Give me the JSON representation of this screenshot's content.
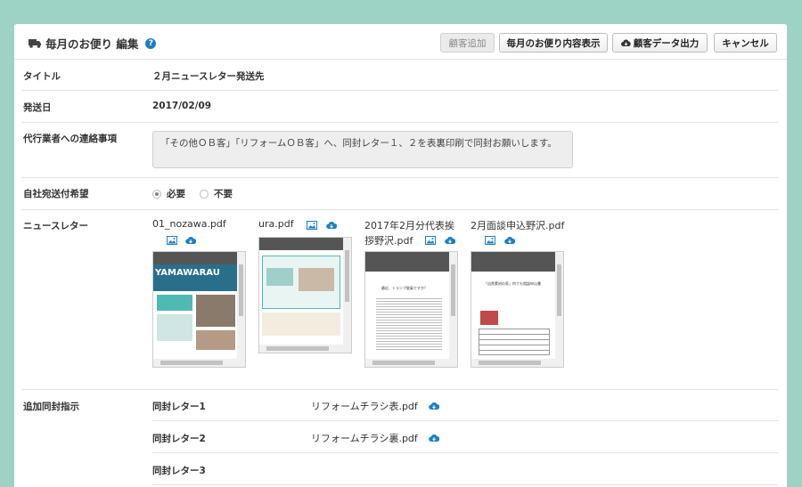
{
  "header": {
    "title": "毎月のお便り 編集",
    "help_icon": "?",
    "buttons": {
      "add_customer": "顧客追加",
      "show_content": "毎月のお便り内容表示",
      "export_data": "顧客データ出力",
      "cancel": "キャンセル"
    }
  },
  "form": {
    "title": {
      "label": "タイトル",
      "value": "２月ニュースレター発送先"
    },
    "send_date": {
      "label": "発送日",
      "value": "2017/02/09"
    },
    "agent_note": {
      "label": "代行業者への連絡事項",
      "value": "「その他ＯＢ客」「リフォームＯＢ客」へ、同封レター１、２を表裏印刷で同封お願いします。"
    },
    "self_send": {
      "label": "自社宛送付希望",
      "options": [
        "必要",
        "不要"
      ],
      "selected": "必要"
    },
    "newsletter": {
      "label": "ニュースレター",
      "files": [
        {
          "name": "01_nozawa.pdf",
          "name2": ""
        },
        {
          "name": "ura.pdf",
          "name2": ""
        },
        {
          "name": "2017年2月分代表挨",
          "name2": "拶野沢.pdf"
        },
        {
          "name": "2月面談申込野沢.pdf",
          "name2": ""
        }
      ],
      "thumb_brand": "YAMAWARAU",
      "thumb_text_1": "最近、トランプ旋風ですか？",
      "thumb_text_2": "「自然素材の家」何でも相談申込書"
    },
    "enclosures": {
      "label": "追加同封指示",
      "items": [
        {
          "label": "同封レター1",
          "file": "リフォームチラシ表.pdf"
        },
        {
          "label": "同封レター2",
          "file": "リフォームチラシ裏.pdf"
        },
        {
          "label": "同封レター3",
          "file": ""
        }
      ]
    }
  },
  "colors": {
    "background": "#9dd3c4",
    "accent": "#1f7fc4"
  }
}
